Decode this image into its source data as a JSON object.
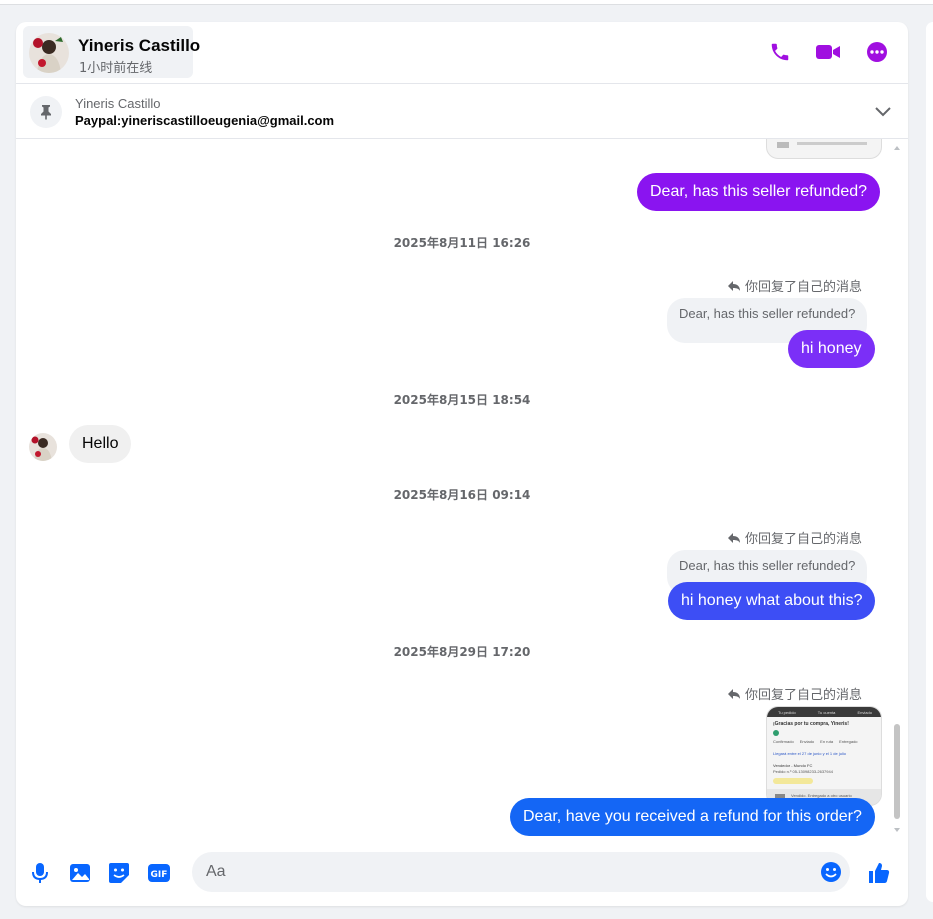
{
  "header": {
    "name": "Yineris Castillo",
    "status": "1小时前在线",
    "accent": "#a00fe0"
  },
  "pinned": {
    "sender": "Yineris Castillo",
    "text": "Paypal:yineriscastilloeugenia@gmail.com"
  },
  "messages": {
    "m1": "Dear, has this seller refunded?",
    "ts1": "2025年8月11日 16:26",
    "replied1": "你回复了自己的消息",
    "quote1": "Dear, has this seller refunded?",
    "m2": "hi honey",
    "ts2": "2025年8月15日 18:54",
    "m3": "Hello",
    "ts3": "2025年8月16日 09:14",
    "replied2": "你回复了自己的消息",
    "quote2": "Dear, has this seller refunded?",
    "m4": "hi honey what about this?",
    "ts4": "2025年8月29日 17:20",
    "replied3": "你回复了自己的消息",
    "m5": "Dear, have you received a refund for this order?"
  },
  "screenshot_thumb": {
    "tabs": [
      "Tu pedido",
      "Tu cuenta",
      "Enviado"
    ],
    "heading": "¡Gracias por tu compra, Yineris!",
    "steps": [
      "Confirmado",
      "Enviado",
      "En ruta",
      "Entregado"
    ],
    "line1": "Llegará entre el 27 de junio y el 1 de julio",
    "line2": "Vendedor - Mundo FC",
    "line3": "Pedido n.º 05-13098233-2637944",
    "footer": "Vendido. Entregado a otro usuario"
  },
  "composer": {
    "placeholder": "Aa"
  }
}
